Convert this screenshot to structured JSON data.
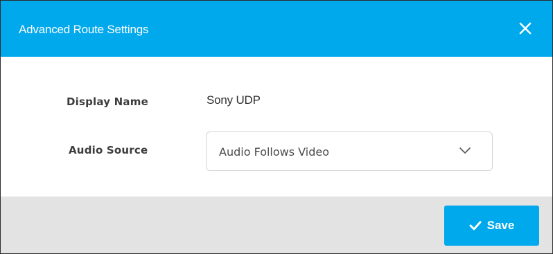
{
  "dialog": {
    "title": "Advanced Route Settings",
    "close_icon": "close-icon"
  },
  "form": {
    "display_name_label": "Display Name",
    "display_name_value": "Sony UDP",
    "audio_source_label": "Audio Source",
    "audio_source_value": "Audio Follows Video",
    "audio_source_icon": "chevron-down-icon"
  },
  "footer": {
    "save_label": "Save",
    "save_icon": "checkmark-icon"
  },
  "colors": {
    "header": "#00a8ec",
    "save_button": "#00a8ec",
    "footer_background": "#e3e3e3"
  }
}
